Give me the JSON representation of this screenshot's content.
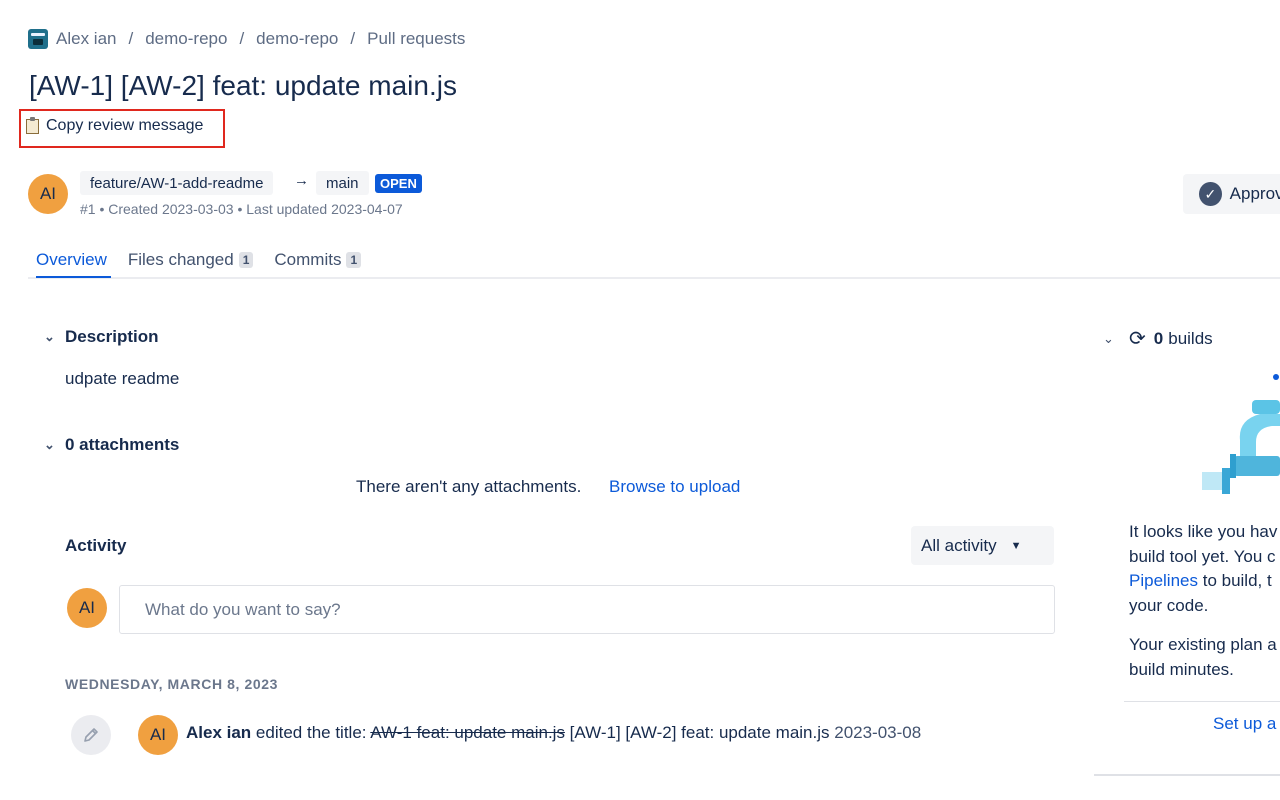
{
  "breadcrumb": {
    "workspace": "Alex ian",
    "project": "demo-repo",
    "repo": "demo-repo",
    "section": "Pull requests",
    "separator": "/"
  },
  "pr": {
    "title": "[AW-1] [AW-2] feat: update main.js",
    "copy_review_label": "Copy review message",
    "author_initials": "AI",
    "source_branch": "feature/AW-1-add-readme",
    "arrow": "→",
    "target_branch": "main",
    "status": "OPEN",
    "meta": "#1 • Created 2023-03-03 • Last updated 2023-04-07",
    "approve_label": "Approve"
  },
  "tabs": [
    {
      "label": "Overview",
      "count": null
    },
    {
      "label": "Files changed",
      "count": "1"
    },
    {
      "label": "Commits",
      "count": "1"
    }
  ],
  "description": {
    "heading": "Description",
    "text": "udpate readme"
  },
  "attachments": {
    "heading": "0 attachments",
    "empty_message": "There aren't any attachments.",
    "browse_link": "Browse to upload"
  },
  "activity": {
    "heading": "Activity",
    "filter": "All activity",
    "comment_placeholder": "What do you want to say?",
    "date_header": "WEDNESDAY, MARCH 8, 2023",
    "event": {
      "author": "Alex ian",
      "action": " edited the title: ",
      "old_title": "AW-1 feat: update main.js",
      "new_title": " [AW-1] [AW-2] feat: update main.js ",
      "date": "2023-03-08"
    }
  },
  "builds": {
    "count": "0",
    "label": "builds",
    "text_line1": "It looks like you hav",
    "text_line2": "build tool yet. You c",
    "text_link": "Pipelines",
    "text_line3_rest": " to build, t",
    "text_line4": "your code.",
    "plan_line1": "Your existing plan a",
    "plan_line2": "build minutes.",
    "setup_link": "Set up a"
  },
  "colors": {
    "accent": "#0c5ad9",
    "avatar": "#f0a040",
    "highlight_border": "#e0281e"
  }
}
